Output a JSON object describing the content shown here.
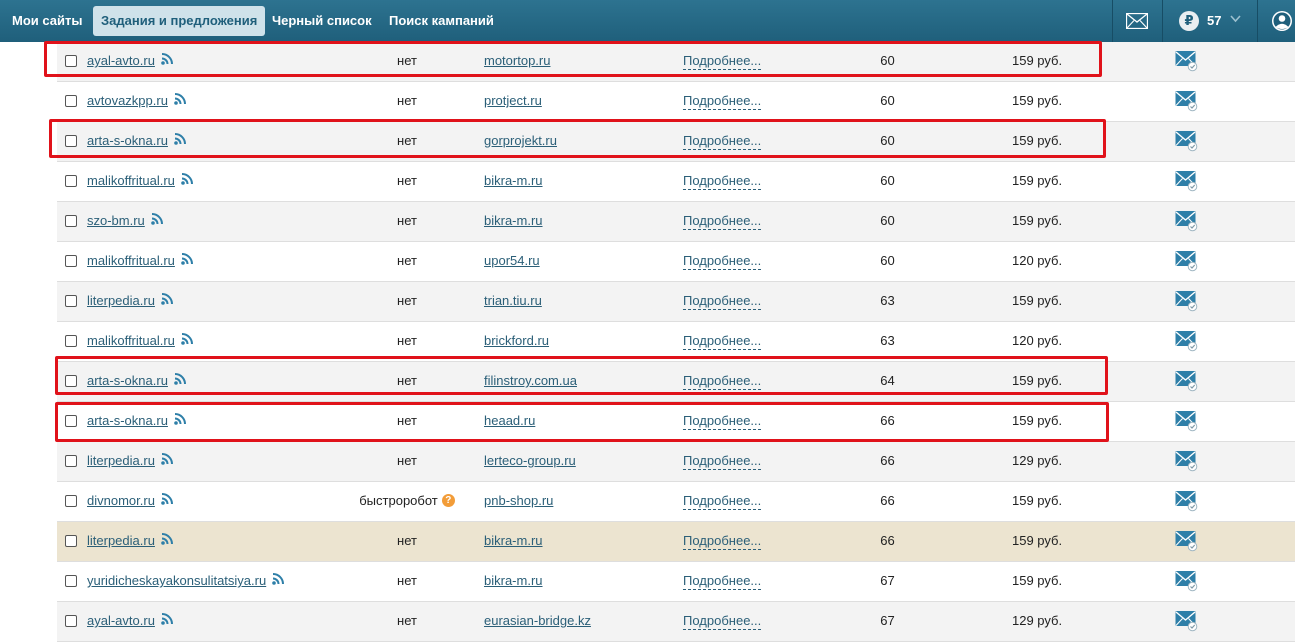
{
  "nav": {
    "items": [
      "Мои сайты",
      "Задания и предложения",
      "Черный список",
      "Поиск кампаний"
    ],
    "balance": "57",
    "currency_symbol": "₽",
    "chevron": "v"
  },
  "table": {
    "more_label": "Подробнее...",
    "rows": [
      {
        "site": "ayal-avto.ru",
        "index": "нет",
        "donor": "motortop.ru",
        "num": "60",
        "price": "159 руб."
      },
      {
        "site": "avtovazkpp.ru",
        "index": "нет",
        "donor": "protject.ru",
        "num": "60",
        "price": "159 руб."
      },
      {
        "site": "arta-s-okna.ru",
        "index": "нет",
        "donor": "gorprojekt.ru",
        "num": "60",
        "price": "159 руб."
      },
      {
        "site": "malikoffritual.ru",
        "index": "нет",
        "donor": "bikra-m.ru",
        "num": "60",
        "price": "159 руб."
      },
      {
        "site": "szo-bm.ru",
        "index": "нет",
        "donor": "bikra-m.ru",
        "num": "60",
        "price": "159 руб."
      },
      {
        "site": "malikoffritual.ru",
        "index": "нет",
        "donor": "upor54.ru",
        "num": "60",
        "price": "120 руб."
      },
      {
        "site": "literpedia.ru",
        "index": "нет",
        "donor": "trian.tiu.ru",
        "num": "63",
        "price": "159 руб."
      },
      {
        "site": "malikoffritual.ru",
        "index": "нет",
        "donor": "brickford.ru",
        "num": "63",
        "price": "120 руб."
      },
      {
        "site": "arta-s-okna.ru",
        "index": "нет",
        "donor": "filinstroy.com.ua",
        "num": "64",
        "price": "159 руб."
      },
      {
        "site": "arta-s-okna.ru",
        "index": "нет",
        "donor": "heaad.ru",
        "num": "66",
        "price": "159 руб."
      },
      {
        "site": "literpedia.ru",
        "index": "нет",
        "donor": "lerteco-group.ru",
        "num": "66",
        "price": "129 руб."
      },
      {
        "site": "divnomor.ru",
        "index": "быстроробот",
        "donor": "pnb-shop.ru",
        "num": "66",
        "price": "159 руб."
      },
      {
        "site": "literpedia.ru",
        "index": "нет",
        "donor": "bikra-m.ru",
        "num": "66",
        "price": "159 руб."
      },
      {
        "site": "yuridicheskayakonsulitatsiya.ru",
        "index": "нет",
        "donor": "bikra-m.ru",
        "num": "67",
        "price": "159 руб."
      },
      {
        "site": "ayal-avto.ru",
        "index": "нет",
        "donor": "eurasian-bridge.kz",
        "num": "67",
        "price": "129 руб."
      }
    ]
  },
  "colors": {
    "topbar": "#1f5f7b",
    "link": "#2b5f78",
    "highlight_row": "#ece4d0",
    "annotation_red": "#e0121a",
    "question_badge": "#f29c38"
  },
  "icons": [
    "mail-icon",
    "ruble-icon",
    "user-icon",
    "rss-icon",
    "mail-send-icon",
    "question-icon",
    "checkbox"
  ]
}
